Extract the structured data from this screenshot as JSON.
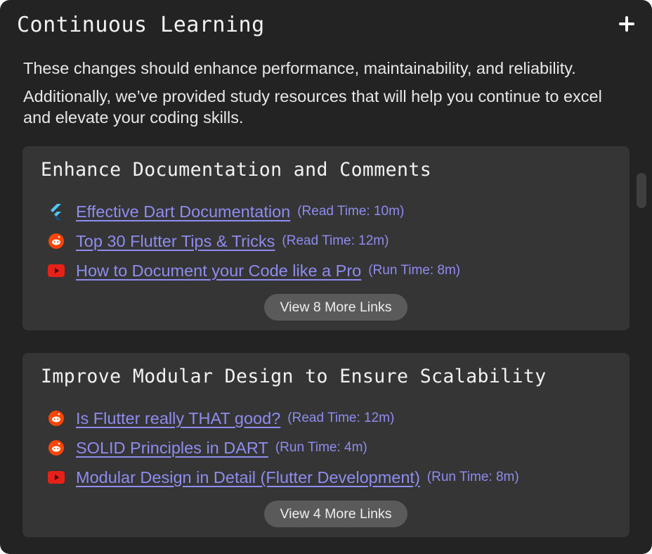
{
  "panel": {
    "title": "Continuous Learning",
    "add_icon": "plus-icon"
  },
  "intro": {
    "line1": "These changes should enhance performance, maintainability, and reliability.",
    "line2": "Additionally, we’ve provided study resources that will help you continue to excel and elevate your coding skills."
  },
  "sections": [
    {
      "title": "Enhance Documentation and Comments",
      "links": [
        {
          "icon": "flutter-icon",
          "text": "Effective Dart Documentation",
          "meta": "(Read Time: 10m)"
        },
        {
          "icon": "reddit-icon",
          "text": "Top 30 Flutter Tips & Tricks",
          "meta": "(Read Time: 12m)"
        },
        {
          "icon": "youtube-icon",
          "text": "How to Document your Code like a Pro",
          "meta": "(Run Time: 8m)"
        }
      ],
      "more_label": "View 8 More Links"
    },
    {
      "title": "Improve Modular Design to Ensure Scalability",
      "links": [
        {
          "icon": "reddit-icon",
          "text": "Is Flutter really THAT good?",
          "meta": "(Read Time: 12m)"
        },
        {
          "icon": "reddit-icon",
          "text": "SOLID Principles in DART",
          "meta": "(Run Time: 4m)"
        },
        {
          "icon": "youtube-icon",
          "text": "Modular Design in Detail (Flutter Development)",
          "meta": "(Run Time: 8m)"
        }
      ],
      "more_label": "View 4 More Links"
    }
  ],
  "colors": {
    "background": "#232323",
    "card": "#353535",
    "link": "#8f8cf0",
    "reddit": "#ff4500",
    "youtube": "#e62117",
    "flutter": "#54c5f8"
  }
}
